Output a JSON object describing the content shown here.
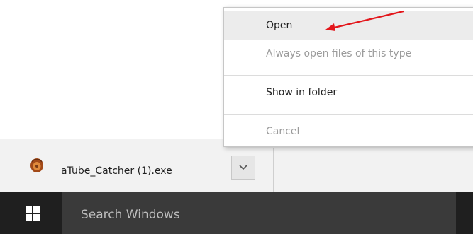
{
  "context_menu": {
    "items": [
      {
        "label": "Open",
        "state": "hover"
      },
      {
        "label": "Always open files of this type",
        "state": "disabled"
      },
      {
        "label": "Show in folder",
        "state": "normal"
      },
      {
        "label": "Cancel",
        "state": "disabled"
      }
    ]
  },
  "download_bar": {
    "file_name": "aTube_Catcher (1).exe",
    "file_icon": "baseball-glove-icon",
    "dropdown_icon": "chevron-down-icon"
  },
  "taskbar": {
    "start_icon": "windows-logo-icon",
    "search_placeholder": "Search Windows"
  },
  "annotation": {
    "arrow_color": "#e3161b"
  }
}
